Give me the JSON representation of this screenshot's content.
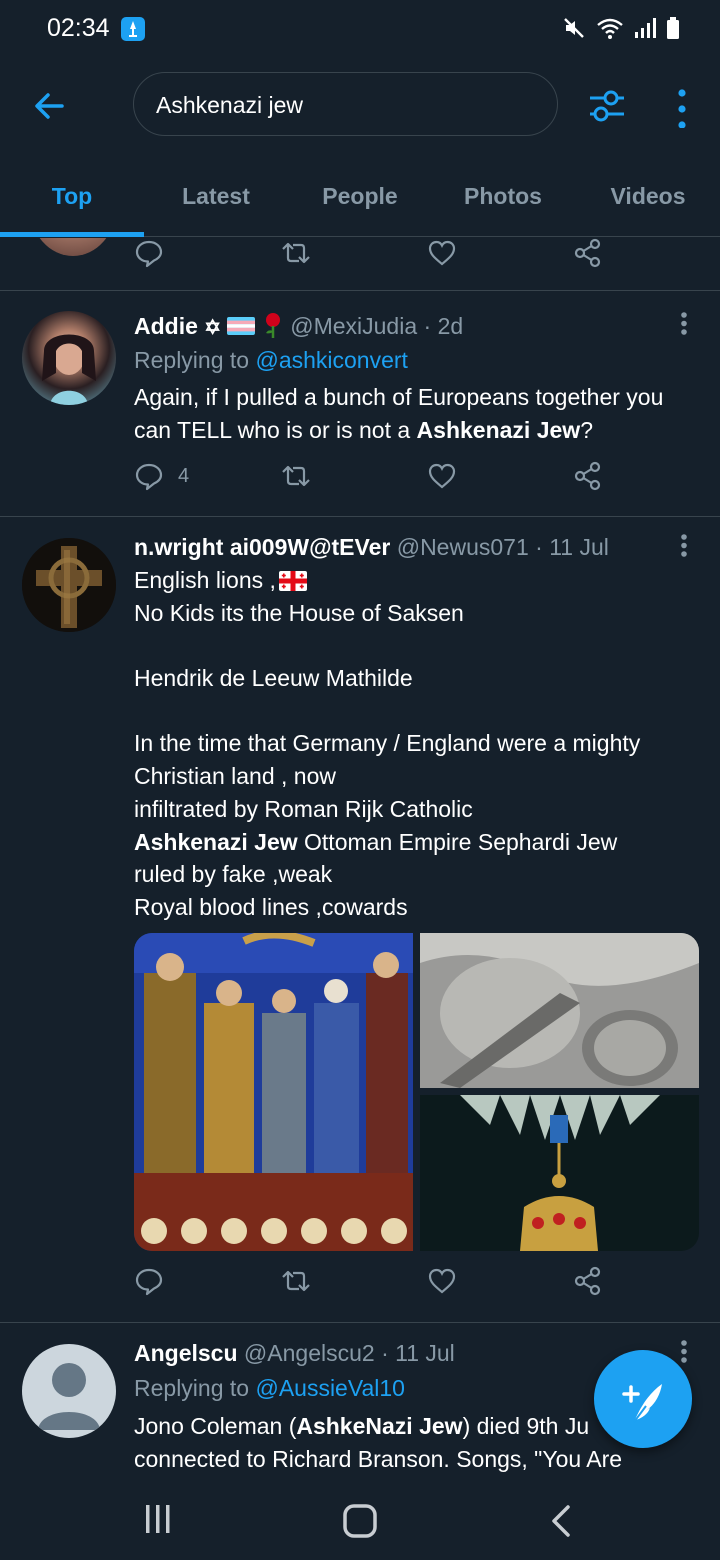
{
  "status_bar": {
    "time": "02:34"
  },
  "search": {
    "query": "Ashkenazi jew"
  },
  "tabs": [
    {
      "label": "Top",
      "active": true
    },
    {
      "label": "Latest",
      "active": false
    },
    {
      "label": "People",
      "active": false
    },
    {
      "label": "Photos",
      "active": false
    },
    {
      "label": "Videos",
      "active": false
    }
  ],
  "tweets": [
    {
      "name": "Addie",
      "name_emoji": "✡",
      "handle": "@MexiJudia",
      "time": "· 2d",
      "replying_label": "Replying to ",
      "replying_to": "@ashkiconvert",
      "text_1": "Again, if I pulled a bunch of Europeans together you can TELL who is or is not a ",
      "highlight": "Ashkenazi Jew",
      "text_2": "?",
      "reply_count": "4"
    },
    {
      "name": "n.wright ai009W@tEVer",
      "handle": "@Newus071",
      "time": "· 11 Jul",
      "lines": [
        "English lions ,",
        "No Kids its the House of Saksen",
        "Hendrik de Leeuw Mathilde",
        "In the time that Germany / England were a mighty Christian land , now",
        "infiltrated by Roman Rijk Catholic",
        "Ottoman Empire Sephardi Jew",
        "ruled by fake ,weak",
        "Royal blood lines ,cowards"
      ],
      "highlight": "Ashkenazi Jew"
    },
    {
      "name": "Angelscu",
      "handle": "@Angelscu2",
      "time": "· 11 Jul",
      "replying_label": "Replying to ",
      "replying_to": "@AussieVal10",
      "text_1": "Jono Coleman (",
      "highlight": "AshkeNazi Jew",
      "text_2": ") died 9th Ju",
      "text_3": "connected to Richard Branson. Songs, \"You Are"
    }
  ],
  "colors": {
    "background": "#15202b",
    "accent": "#1da1f2",
    "secondary_text": "#8899a6",
    "divider": "#38444d"
  }
}
